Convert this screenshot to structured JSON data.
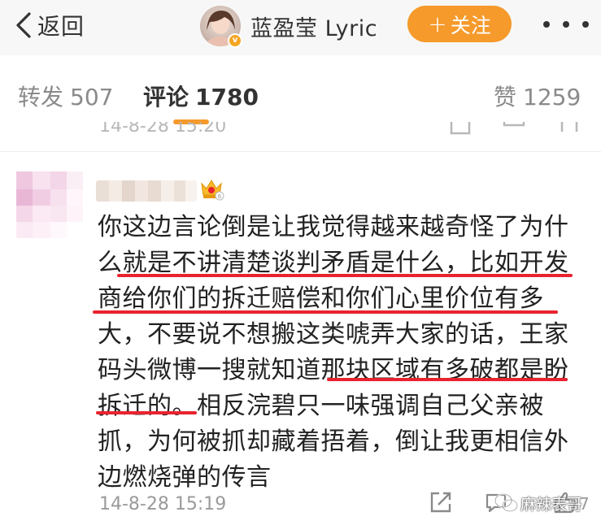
{
  "navbar": {
    "back_label": "返回",
    "user_name": "蓝盈莹 Lyric",
    "follow_label": "关注"
  },
  "tabs": [
    {
      "label": "转发",
      "count": "507"
    },
    {
      "label": "评论",
      "count": "1780",
      "active": true
    },
    {
      "label": "赞",
      "count": "1259"
    }
  ],
  "previous_comment": {
    "time": "14-8-28 15:20"
  },
  "comment": {
    "lines": [
      "你这边言论倒是让我觉得越来越奇怪了为什",
      "么就是不讲清楚谈判矛盾是什么，比如开发",
      "商给你们的拆迁赔偿和你们心里价位有多",
      "大，不要说不想搬这类唬弄大家的话，王家",
      "码头微博一搜就知道那块区域有多破都是盼",
      "拆迁的。相反浣碧只一味强调自己父亲被",
      "抓，为何被抓却藏着捂着，倒让我更相信外",
      "边燃烧弹的传言"
    ],
    "time": "14-8-28 15:19",
    "like_count": "7"
  },
  "watermark": {
    "text": "麻辣表哥"
  },
  "colors": {
    "accent": "#f59a2b",
    "highlight": "#e8232f",
    "muted_text": "#9a9a9a"
  },
  "icons": [
    "back-chevron-icon",
    "verified-badge-icon",
    "plus-icon",
    "more-dots-icon",
    "crown-icon",
    "share-icon",
    "comment-icon",
    "like-icon"
  ]
}
